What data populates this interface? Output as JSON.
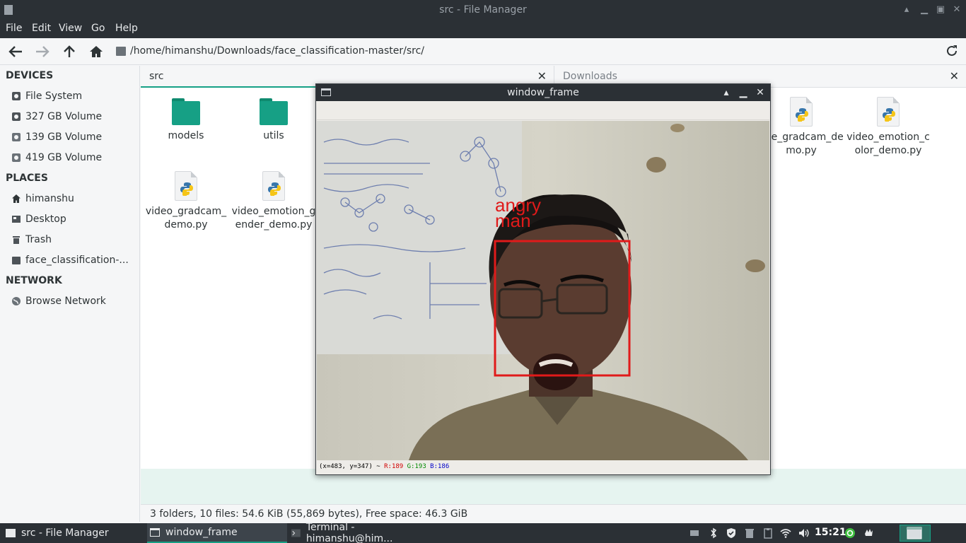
{
  "window": {
    "title": "src - File Manager",
    "controls": [
      "minimize",
      "maximize",
      "close"
    ]
  },
  "menu": [
    "File",
    "Edit",
    "View",
    "Go",
    "Help"
  ],
  "toolbar": {
    "path": "/home/himanshu/Downloads/face_classification-master/src/"
  },
  "sidebar": {
    "devices_heading": "DEVICES",
    "devices": [
      "File System",
      "327 GB Volume",
      "139 GB Volume",
      "419 GB Volume"
    ],
    "places_heading": "PLACES",
    "places": [
      "himanshu",
      "Desktop",
      "Trash",
      "face_classification-..."
    ],
    "network_heading": "NETWORK",
    "network": [
      "Browse Network"
    ]
  },
  "left_pane": {
    "tab_label": "src",
    "files": [
      {
        "name": "models",
        "kind": "folder"
      },
      {
        "name": "utils",
        "kind": "folder"
      },
      {
        "name": "video_gradcam_demo.py",
        "kind": "python"
      },
      {
        "name": "video_emotion_gender_demo.py",
        "kind": "python"
      }
    ]
  },
  "right_pane": {
    "tab_label": "Downloads",
    "files": [
      {
        "name": "image_gradcam_demo.py",
        "visible": "age_gradcam_demo.py",
        "kind": "python"
      },
      {
        "name": "video_emotion_color_demo.py",
        "kind": "python"
      }
    ]
  },
  "statusbar": {
    "text": "3 folders, 10 files: 54.6 KiB (55,869 bytes), Free space: 46.3 GiB"
  },
  "cv_window": {
    "title": "window_frame",
    "labels": [
      "angry",
      "man"
    ],
    "status_prefix": "(x=483, y=347) ~ ",
    "status_r": "R:189",
    "status_g": "G:193",
    "status_b": "B:186"
  },
  "taskbar": {
    "tasks": [
      "src - File Manager",
      "window_frame",
      "Terminal - himanshu@him..."
    ],
    "clock": "15:21"
  },
  "colors": {
    "accent": "#16a085",
    "dark": "#2b3035",
    "bbox": "#e01a1a"
  }
}
